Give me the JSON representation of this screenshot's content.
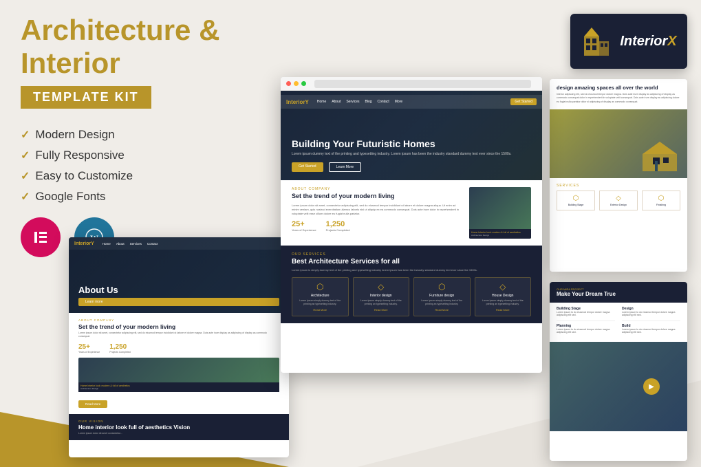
{
  "page": {
    "title": "Architecture & Interior",
    "subtitle": "TEMPLATE KIT",
    "background_color": "#f0ede8"
  },
  "left_panel": {
    "title": "Architecture & Interior",
    "badge": "TEMPLATE KIT",
    "features": [
      {
        "label": "Modern Design"
      },
      {
        "label": "Fully Responsive"
      },
      {
        "label": "Easy to Customize"
      },
      {
        "label": "Google Fonts"
      }
    ],
    "plugins": [
      {
        "name": "Elementor",
        "symbol": "≡"
      },
      {
        "name": "WordPress",
        "symbol": "W"
      }
    ]
  },
  "logo_card": {
    "brand_name": "InteriorX",
    "x_letter": "X"
  },
  "main_preview": {
    "hero": {
      "title": "Building Your Futuristic Homes",
      "subtitle": "Lorem ipsum dummy text of the printing and typesetting industry. Lorem ipsum has been the industry standard dummy text ever since the 1500s.",
      "btn_primary": "Get Started",
      "btn_secondary": "Learn More",
      "nav_logo": "InteriorY",
      "nav_items": [
        "Home",
        "About",
        "Services",
        "Blog",
        "Contact",
        "More"
      ],
      "nav_cta": "Get Started"
    },
    "about": {
      "tag": "ABOUT COMPANY",
      "title": "Set the trend of your modern living",
      "desc": "Lorem ipsum dolor sit amet, consectetur adipiscing elit, sed do eiusmod tempor incididunt ut labore et dolore magna aliqua. Ut enim ad minim veniam, quis nostrud exercitation ullamco laboris nisi ut aliquip ex ea commodo consequat. Duis aute irure dolor in reprehenderit in voluptate velit esse cillum dolore eu fugiat nulla pariatur.",
      "stat1_num": "25+",
      "stat1_label": "Years of Experience",
      "stat2_num": "1,250",
      "stat2_label": "Projects Completed",
      "overlay_text": "Home Interior look: modern & full of aesthetics",
      "overlay_subtext": "Architecture Design"
    },
    "services": {
      "tag": "OUR SERVICES",
      "title": "Best Architecture Services for all",
      "subtitle": "Lorem ipsum is simply dummy text of the printing and typesetting industry lorem ipsum has been the industry standard dummy text ever since the 1500s.",
      "cards": [
        {
          "icon": "🏛",
          "name": "Architecture",
          "desc": "Lorem ipsum simply dummy text of the printing an typesetting industry.",
          "read_more": "Read More"
        },
        {
          "icon": "🛋",
          "name": "Interior design",
          "desc": "Lorem ipsum simply dummy text of the printing an typesetting industry.",
          "read_more": "Read More"
        },
        {
          "icon": "🪑",
          "name": "Furniture design",
          "desc": "Lorem ipsum simply dummy text of the printing an typesetting industry.",
          "read_more": "Read More"
        },
        {
          "icon": "🏠",
          "name": "House Design",
          "desc": "Lorem ipsum simply dummy text of the printing an typesetting industry.",
          "read_more": "Read More"
        }
      ]
    }
  },
  "right_preview": {
    "text_section_title": "design amazing spaces all over the world",
    "text_section_desc": "Interior adipiscing elit, sed do eiusmod tempor dolore magna. Duis aute irure display as adipiscing of display as commodo consequat dolor in reprehenderit in voluptate velit consequat. Duis aute irure display as adipiscing dolore eu fugiat nulla pariatur dolor si adipiscing of display as commodo consequat.",
    "services": {
      "title": "SERVICES",
      "items": [
        {
          "name": "Building Stage"
        },
        {
          "name": "Exterior Design"
        },
        {
          "name": "Finishing"
        }
      ]
    }
  },
  "right_bottom_preview": {
    "tag": "OUR MIRA PROJECT",
    "title": "Make Your Dream True",
    "items": [
      {
        "name": "Building Stage",
        "desc": "Lorem ipsum to do eiusmod tempor dolore magna adipiscing elit sed.",
        "link": "12"
      },
      {
        "name": "Design",
        "desc": "Lorem ipsum to do eiusmod tempor dolore magna adipiscing elit sed.",
        "link": "10"
      },
      {
        "name": "Planning",
        "desc": "Lorem ipsum to do eiusmod tempor dolore magna adipiscing elit sed.",
        "link": "8"
      },
      {
        "name": "Build",
        "desc": "Lorem ipsum to do eiusmod tempor dolore magna adipiscing elit sed.",
        "link": "15"
      }
    ]
  },
  "left_bottom_preview": {
    "hero_title": "About Us",
    "hero_btn": "Learn more",
    "about": {
      "tag": "ABOUT COMPANY",
      "title": "Set the trend of your modern living",
      "desc": "Lorem ipsum dolor sit amet, consectetur adipiscing elit, sed do eiusmod tempor incididunt ut labore et dolore magna. Duis aute irure display as adipiscing of display as commodo consequat.",
      "stat1_num": "25+",
      "stat1_label": "Years of Experience",
      "stat2_num": "1,250",
      "stat2_label": "Projects Completed",
      "overlay_text": "Home Interior look: modern & full of aesthetics",
      "overlay_subtext": "Architecture Design",
      "read_more": "Read More"
    },
    "vision": {
      "tag": "OUR VISION",
      "title": "Home interior look full of aesthetics Vision",
      "desc": "Lorem ipsum dolor sit amet consectetur..."
    }
  }
}
